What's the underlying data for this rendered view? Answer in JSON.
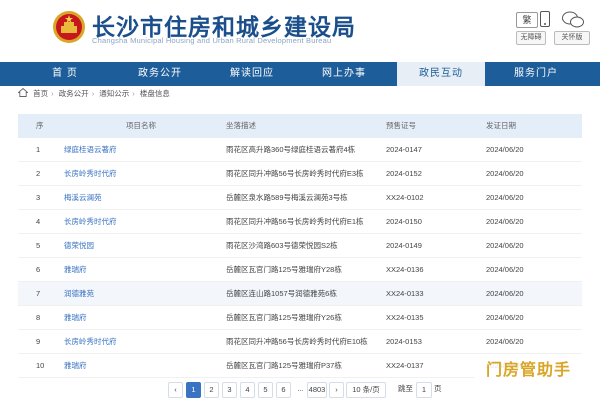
{
  "header": {
    "title": "长沙市住房和城乡建设局",
    "subtitle": "Changsha Municipal Housing and Urban Rural Development Bureau",
    "tool_fan": "繁",
    "accessibility": "无障碍",
    "elder": "关怀版"
  },
  "nav": [
    "首 页",
    "政务公开",
    "解读回应",
    "网上办事",
    "政民互动",
    "服务门户"
  ],
  "breadcrumb": [
    "首页",
    "政务公开",
    "通知公示",
    "楼盘信息"
  ],
  "table": {
    "headers": [
      "序",
      "项目名称",
      "坐落描述",
      "预售证号",
      "发证日期"
    ],
    "rows": [
      {
        "no": "1",
        "name": "绿庭桂语云著府",
        "addr": "雨花区高升路360号绿庭桂语云著府4栋",
        "license": "2024-0147",
        "date": "2024/06/20"
      },
      {
        "no": "2",
        "name": "长房岭秀时代府",
        "addr": "雨花区同升冲路56号长房岭秀时代府E3栋",
        "license": "2024-0152",
        "date": "2024/06/20"
      },
      {
        "no": "3",
        "name": "梅溪云澜苑",
        "addr": "岳麓区泉水路589号梅溪云澜苑3号栋",
        "license": "XX24-0102",
        "date": "2024/06/20"
      },
      {
        "no": "4",
        "name": "长房岭秀时代府",
        "addr": "雨花区同升冲路56号长房岭秀时代府E1栋",
        "license": "2024-0150",
        "date": "2024/06/20"
      },
      {
        "no": "5",
        "name": "德荣悦园",
        "addr": "雨花区沙湾路603号德荣悦园S2栋",
        "license": "2024-0149",
        "date": "2024/06/20"
      },
      {
        "no": "6",
        "name": "雅瑞府",
        "addr": "岳麓区瓦官门路125号雅瑞府Y28栋",
        "license": "XX24-0136",
        "date": "2024/06/20"
      },
      {
        "no": "7",
        "name": "润德雅苑",
        "addr": "岳麓区连山路1057号润德雅苑6栋",
        "license": "XX24-0133",
        "date": "2024/06/20"
      },
      {
        "no": "8",
        "name": "雅瑞府",
        "addr": "岳麓区瓦官门路125号雅瑞府Y26栋",
        "license": "XX24-0135",
        "date": "2024/06/20"
      },
      {
        "no": "9",
        "name": "长房岭秀时代府",
        "addr": "雨花区同升冲路56号长房岭秀时代府E10栋",
        "license": "2024-0153",
        "date": "2024/06/20"
      },
      {
        "no": "10",
        "name": "雅瑞府",
        "addr": "岳麓区瓦官门路125号雅瑞府P37栋",
        "license": "XX24-0137",
        "date": "2024/06/20"
      }
    ]
  },
  "pagination": {
    "prev": "‹",
    "pages": [
      "1",
      "2",
      "3",
      "4",
      "5",
      "6"
    ],
    "ellipsis": "...",
    "last": "4803",
    "next": "›",
    "page_size": "10",
    "page_size_unit": "条/页",
    "jump_label": "跳至",
    "jump_value": "1",
    "jump_unit": "页"
  },
  "watermark": "门房管助手",
  "colors": {
    "nav": "#1d5d99",
    "title": "#1a4f8c",
    "link": "#3a73c2",
    "header_row": "#e4eef9"
  }
}
